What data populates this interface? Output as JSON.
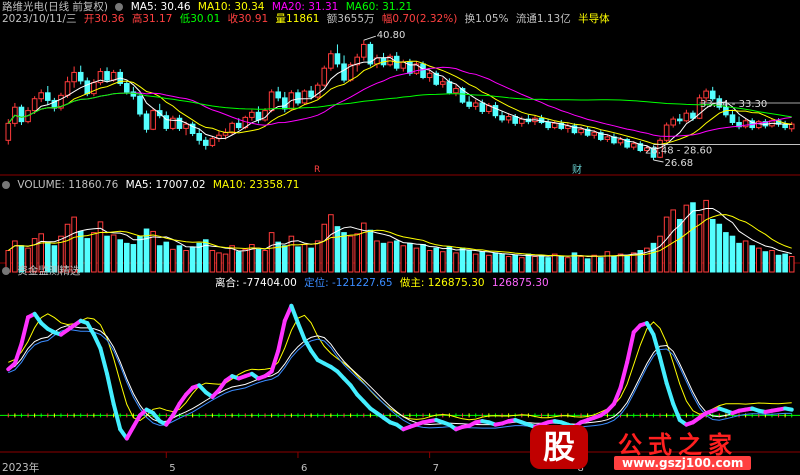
{
  "header": {
    "title": "路维光电(日线 前复权)",
    "ma": [
      {
        "label": "MA5: 30.46",
        "color": "#ffffff"
      },
      {
        "label": "MA10: 30.34",
        "color": "#ffff00"
      },
      {
        "label": "MA20: 31.31",
        "color": "#ff00ff"
      },
      {
        "label": "MA60: 31.21",
        "color": "#00ff00"
      }
    ]
  },
  "quote": [
    {
      "text": "2023/10/11/三",
      "color": "#c0c0c0"
    },
    {
      "text": "开30.36",
      "color": "#ff4040"
    },
    {
      "text": "高31.17",
      "color": "#ff4040"
    },
    {
      "text": "低30.01",
      "color": "#00ff00"
    },
    {
      "text": "收30.91",
      "color": "#ff4040"
    },
    {
      "text": "量11861",
      "color": "#ffff00"
    },
    {
      "text": "额3655万",
      "color": "#c0c0c0"
    },
    {
      "text": "幅0.70(2.32%)",
      "color": "#ff4040"
    },
    {
      "text": "换1.05%",
      "color": "#c0c0c0"
    },
    {
      "text": "流通1.13亿",
      "color": "#c0c0c0"
    },
    {
      "text": "半导体",
      "color": "#ffff00"
    }
  ],
  "price_annotations": {
    "high": "40.80",
    "low": "26.68",
    "range1": "33.44 - 33.30",
    "range2": "28.48 - 28.60",
    "r": "R",
    "cai": "财"
  },
  "volume_header": {
    "title": "VOLUME: 11860.76",
    "ma5": "MA5: 17007.02",
    "ma10": "MA10: 23358.71",
    "title_color": "#c0c0c0",
    "ma5_color": "#ffffff",
    "ma10_color": "#ffff00"
  },
  "indicator_header": {
    "title": "资金监测精选",
    "items": [
      {
        "text": "离合: -77404.00",
        "color": "#ffffff"
      },
      {
        "text": "定位: -121227.65",
        "color": "#3a8cff"
      },
      {
        "text": "做主: 126875.30",
        "color": "#ffff00"
      },
      {
        "text": "126875.30",
        "color": "#ff66ff"
      }
    ]
  },
  "x_axis": {
    "year": "2023年",
    "months": [
      "5",
      "6",
      "7",
      "8"
    ]
  },
  "watermark": {
    "logo": "股",
    "name": "公式之家",
    "url": "www.gszj100.com"
  },
  "colors": {
    "up": "#ff3b3b",
    "down": "#54ffff",
    "ma5": "#ffffff",
    "ma10": "#ffff00",
    "ma20": "#ff00ff",
    "ma60": "#00ff00",
    "separator": "#8b0000"
  },
  "candles": [
    [
      29.0,
      31.5,
      28.5,
      31.0
    ],
    [
      31.0,
      33.4,
      30.6,
      32.9
    ],
    [
      32.9,
      33.2,
      30.8,
      31.2
    ],
    [
      31.2,
      32.9,
      31.0,
      32.5
    ],
    [
      32.5,
      34.2,
      32.1,
      33.9
    ],
    [
      33.9,
      35.0,
      33.5,
      34.6
    ],
    [
      34.6,
      35.4,
      33.2,
      33.7
    ],
    [
      33.7,
      34.0,
      32.4,
      32.8
    ],
    [
      32.8,
      34.6,
      32.5,
      34.3
    ],
    [
      34.3,
      36.5,
      34.0,
      35.9
    ],
    [
      35.9,
      37.7,
      35.2,
      37.0
    ],
    [
      37.0,
      37.8,
      35.6,
      36.0
    ],
    [
      36.0,
      36.4,
      34.2,
      34.5
    ],
    [
      34.5,
      36.2,
      34.2,
      35.8
    ],
    [
      35.8,
      37.5,
      35.5,
      37.1
    ],
    [
      37.1,
      37.6,
      35.8,
      36.1
    ],
    [
      36.1,
      37.3,
      35.9,
      37.0
    ],
    [
      37.0,
      37.4,
      35.4,
      35.7
    ],
    [
      35.7,
      36.0,
      34.4,
      34.7
    ],
    [
      34.7,
      35.3,
      33.8,
      34.2
    ],
    [
      34.2,
      34.6,
      31.8,
      32.1
    ],
    [
      32.1,
      32.5,
      29.9,
      30.3
    ],
    [
      30.3,
      32.8,
      30.2,
      32.5
    ],
    [
      32.5,
      33.3,
      31.6,
      31.9
    ],
    [
      31.9,
      32.4,
      30.1,
      30.4
    ],
    [
      30.4,
      31.9,
      30.2,
      31.6
    ],
    [
      31.6,
      32.0,
      30.1,
      30.4
    ],
    [
      30.4,
      31.2,
      29.6,
      30.9
    ],
    [
      30.9,
      31.2,
      29.5,
      29.8
    ],
    [
      29.8,
      30.4,
      28.5,
      29.0
    ],
    [
      29.0,
      29.4,
      27.9,
      28.4
    ],
    [
      28.4,
      29.5,
      28.2,
      29.2
    ],
    [
      29.2,
      30.1,
      28.8,
      29.6
    ],
    [
      29.6,
      30.4,
      29.1,
      29.9
    ],
    [
      29.9,
      31.2,
      29.7,
      31.0
    ],
    [
      31.0,
      31.6,
      30.2,
      30.5
    ],
    [
      30.5,
      31.9,
      30.3,
      31.7
    ],
    [
      31.7,
      32.6,
      31.3,
      32.3
    ],
    [
      32.3,
      33.0,
      31.0,
      31.4
    ],
    [
      31.4,
      32.8,
      31.2,
      32.5
    ],
    [
      32.5,
      35.0,
      32.3,
      34.7
    ],
    [
      34.7,
      35.3,
      33.6,
      34.0
    ],
    [
      34.0,
      34.7,
      32.3,
      32.7
    ],
    [
      32.7,
      34.9,
      32.6,
      34.6
    ],
    [
      34.6,
      35.0,
      33.1,
      33.4
    ],
    [
      33.4,
      35.0,
      33.2,
      34.8
    ],
    [
      34.8,
      35.4,
      33.8,
      34.1
    ],
    [
      34.1,
      35.8,
      33.9,
      35.5
    ],
    [
      35.5,
      37.8,
      35.3,
      37.5
    ],
    [
      37.5,
      39.6,
      37.2,
      39.2
    ],
    [
      39.2,
      40.3,
      37.6,
      38.0
    ],
    [
      38.0,
      39.0,
      35.8,
      36.1
    ],
    [
      36.1,
      38.2,
      35.9,
      37.9
    ],
    [
      37.9,
      39.2,
      37.1,
      38.8
    ],
    [
      38.8,
      40.8,
      38.4,
      40.3
    ],
    [
      40.3,
      40.6,
      37.7,
      38.0
    ],
    [
      38.0,
      39.1,
      37.5,
      38.7
    ],
    [
      38.7,
      39.3,
      37.6,
      37.9
    ],
    [
      37.9,
      39.2,
      37.7,
      38.9
    ],
    [
      38.9,
      39.4,
      37.2,
      37.5
    ],
    [
      37.5,
      38.5,
      37.1,
      38.2
    ],
    [
      38.2,
      38.6,
      36.6,
      36.9
    ],
    [
      36.9,
      38.3,
      36.7,
      38.0
    ],
    [
      38.0,
      38.3,
      36.2,
      36.4
    ],
    [
      36.4,
      37.3,
      35.9,
      36.9
    ],
    [
      36.9,
      37.2,
      35.4,
      35.6
    ],
    [
      35.6,
      36.4,
      35.2,
      35.9
    ],
    [
      35.9,
      36.3,
      34.4,
      34.6
    ],
    [
      34.6,
      35.5,
      34.2,
      35.1
    ],
    [
      35.1,
      35.3,
      33.3,
      33.5
    ],
    [
      33.5,
      34.2,
      32.7,
      33.0
    ],
    [
      33.0,
      33.8,
      32.6,
      33.4
    ],
    [
      33.4,
      33.8,
      32.1,
      32.4
    ],
    [
      32.4,
      33.4,
      32.1,
      33.1
    ],
    [
      33.1,
      33.5,
      31.6,
      31.9
    ],
    [
      31.9,
      32.4,
      31.1,
      31.4
    ],
    [
      31.4,
      32.2,
      31.0,
      31.8
    ],
    [
      31.8,
      32.1,
      30.7,
      31.0
    ],
    [
      31.0,
      31.8,
      30.6,
      31.5
    ],
    [
      31.5,
      32.0,
      30.9,
      31.2
    ],
    [
      31.2,
      31.9,
      30.8,
      31.6
    ],
    [
      31.6,
      32.0,
      30.9,
      31.1
    ],
    [
      31.1,
      31.5,
      30.2,
      30.5
    ],
    [
      30.5,
      31.3,
      30.3,
      31.0
    ],
    [
      31.0,
      31.4,
      30.2,
      30.4
    ],
    [
      30.4,
      31.0,
      29.9,
      30.7
    ],
    [
      30.7,
      31.0,
      29.7,
      29.9
    ],
    [
      29.9,
      30.6,
      29.6,
      30.3
    ],
    [
      30.3,
      30.6,
      29.4,
      29.6
    ],
    [
      29.6,
      30.2,
      29.2,
      29.9
    ],
    [
      29.9,
      30.2,
      28.9,
      29.1
    ],
    [
      29.1,
      29.7,
      28.8,
      29.4
    ],
    [
      29.4,
      29.8,
      28.5,
      28.7
    ],
    [
      28.7,
      29.4,
      28.4,
      29.1
    ],
    [
      29.1,
      29.3,
      28.0,
      28.2
    ],
    [
      28.2,
      28.9,
      27.9,
      28.6
    ],
    [
      28.6,
      28.9,
      27.6,
      27.8
    ],
    [
      27.8,
      28.4,
      27.5,
      28.1
    ],
    [
      28.1,
      28.4,
      26.68,
      27.0
    ],
    [
      27.0,
      29.3,
      26.9,
      29.0
    ],
    [
      29.0,
      31.1,
      28.8,
      30.8
    ],
    [
      30.8,
      31.8,
      30.5,
      31.5
    ],
    [
      31.5,
      32.1,
      30.9,
      31.3
    ],
    [
      31.3,
      32.6,
      31.1,
      32.2
    ],
    [
      32.2,
      32.5,
      31.3,
      31.6
    ],
    [
      31.6,
      34.4,
      31.5,
      34.0
    ],
    [
      34.0,
      35.1,
      33.5,
      34.8
    ],
    [
      34.8,
      35.3,
      33.6,
      33.9
    ],
    [
      33.9,
      34.3,
      32.6,
      32.9
    ],
    [
      32.9,
      33.4,
      31.7,
      32.0
    ],
    [
      32.0,
      32.6,
      30.8,
      31.1
    ],
    [
      31.1,
      31.8,
      30.3,
      30.6
    ],
    [
      30.6,
      31.6,
      30.4,
      31.3
    ],
    [
      31.3,
      31.6,
      30.2,
      30.5
    ],
    [
      30.5,
      31.4,
      30.3,
      31.2
    ],
    [
      31.2,
      31.5,
      30.4,
      30.7
    ],
    [
      30.7,
      31.6,
      30.5,
      31.3
    ],
    [
      31.3,
      31.6,
      30.6,
      30.9
    ],
    [
      30.9,
      31.3,
      30.2,
      30.5
    ],
    [
      30.36,
      31.17,
      30.01,
      30.91
    ]
  ],
  "volumes": [
    18,
    26,
    22,
    20,
    28,
    32,
    25,
    22,
    30,
    40,
    46,
    34,
    28,
    33,
    42,
    30,
    31,
    27,
    24,
    23,
    30,
    36,
    34,
    22,
    25,
    19,
    22,
    18,
    21,
    24,
    27,
    18,
    16,
    15,
    22,
    17,
    19,
    23,
    19,
    18,
    33,
    25,
    22,
    30,
    21,
    23,
    20,
    26,
    40,
    48,
    38,
    33,
    30,
    32,
    41,
    35,
    26,
    24,
    25,
    26,
    22,
    24,
    20,
    23,
    18,
    20,
    17,
    21,
    16,
    20,
    18,
    15,
    17,
    14,
    16,
    15,
    13,
    14,
    12,
    15,
    13,
    14,
    12,
    15,
    13,
    12,
    16,
    13,
    11,
    14,
    12,
    17,
    13,
    15,
    14,
    16,
    18,
    20,
    24,
    30,
    46,
    52,
    44,
    56,
    58,
    48,
    60,
    44,
    40,
    33,
    30,
    24,
    26,
    22,
    20,
    17,
    18,
    14,
    15,
    13
  ],
  "indicator": [
    40,
    45,
    62,
    85,
    88,
    80,
    75,
    72,
    70,
    74,
    78,
    82,
    80,
    70,
    58,
    36,
    10,
    -12,
    -20,
    -10,
    0,
    5,
    2,
    -5,
    -8,
    0,
    10,
    18,
    24,
    26,
    20,
    16,
    22,
    30,
    34,
    32,
    34,
    36,
    32,
    34,
    38,
    56,
    82,
    95,
    80,
    66,
    56,
    48,
    45,
    42,
    38,
    32,
    26,
    18,
    12,
    6,
    2,
    -2,
    -6,
    -8,
    -12,
    -10,
    -8,
    -6,
    -5,
    -4,
    -6,
    -8,
    -12,
    -10,
    -9,
    -6,
    -5,
    -6,
    -8,
    -7,
    -5,
    -4,
    -6,
    -8,
    -10,
    -8,
    -6,
    -5,
    -6,
    -8,
    -10,
    -6,
    -4,
    -2,
    0,
    4,
    10,
    24,
    46,
    72,
    78,
    80,
    70,
    50,
    28,
    10,
    -4,
    -8,
    -6,
    -2,
    2,
    4,
    6,
    4,
    2,
    4,
    5,
    6,
    4,
    3,
    4,
    5,
    6,
    5
  ]
}
